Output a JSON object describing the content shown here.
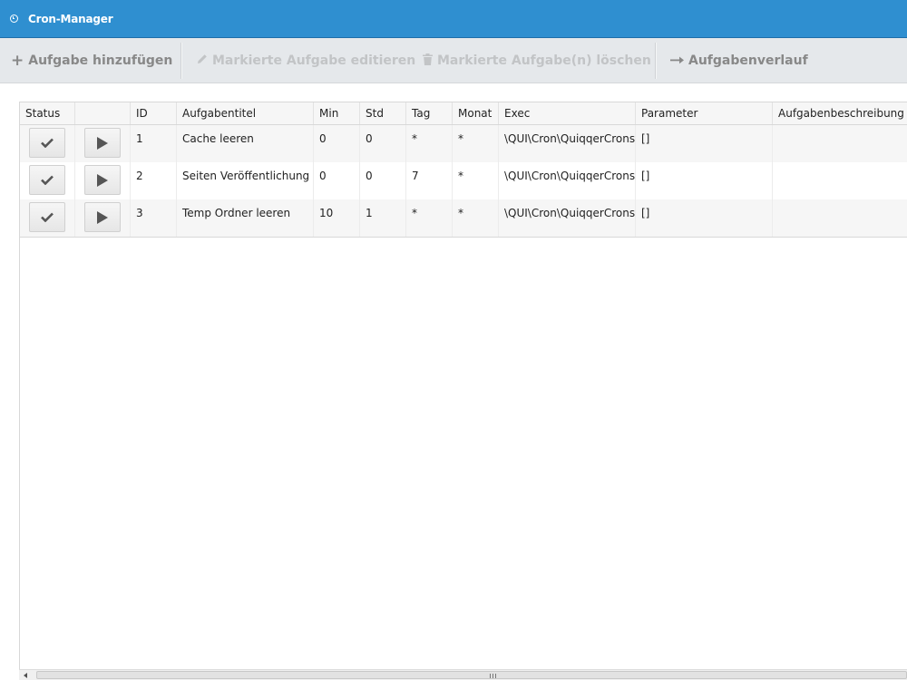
{
  "window": {
    "title": "Cron-Manager"
  },
  "toolbar": {
    "add_label": "Aufgabe hinzufügen",
    "edit_label": "Markierte Aufgabe editieren",
    "delete_label": "Markierte Aufgabe(n) löschen",
    "history_label": "Aufgabenverlauf"
  },
  "grid": {
    "columns": [
      "Status",
      "",
      "ID",
      "Aufgabentitel",
      "Min",
      "Std",
      "Tag",
      "Monat",
      "Exec",
      "Parameter",
      "Aufgabenbeschreibung"
    ],
    "rows": [
      {
        "id": "1",
        "title": "Cache leeren",
        "min": "0",
        "std": "0",
        "tag": "*",
        "monat": "*",
        "exec": "\\QUI\\Cron\\QuiqqerCrons",
        "params": "[]",
        "desc": ""
      },
      {
        "id": "2",
        "title": "Seiten Veröffentlichung",
        "min": "0",
        "std": "0",
        "tag": "7",
        "monat": "*",
        "exec": "\\QUI\\Cron\\QuiqqerCrons",
        "params": "[]",
        "desc": ""
      },
      {
        "id": "3",
        "title": "Temp Ordner leeren",
        "min": "10",
        "std": "1",
        "tag": "*",
        "monat": "*",
        "exec": "\\QUI\\Cron\\QuiqqerCrons",
        "params": "[]",
        "desc": ""
      }
    ]
  },
  "icons": {
    "title": "clock-icon",
    "add": "plus-icon",
    "edit": "pencil-icon",
    "delete": "trash-icon",
    "history": "arrow-right-icon",
    "status": "check-icon",
    "run": "play-icon"
  },
  "colors": {
    "titlebar": "#2f8fd0",
    "toolbar": "#e5e8eb"
  }
}
